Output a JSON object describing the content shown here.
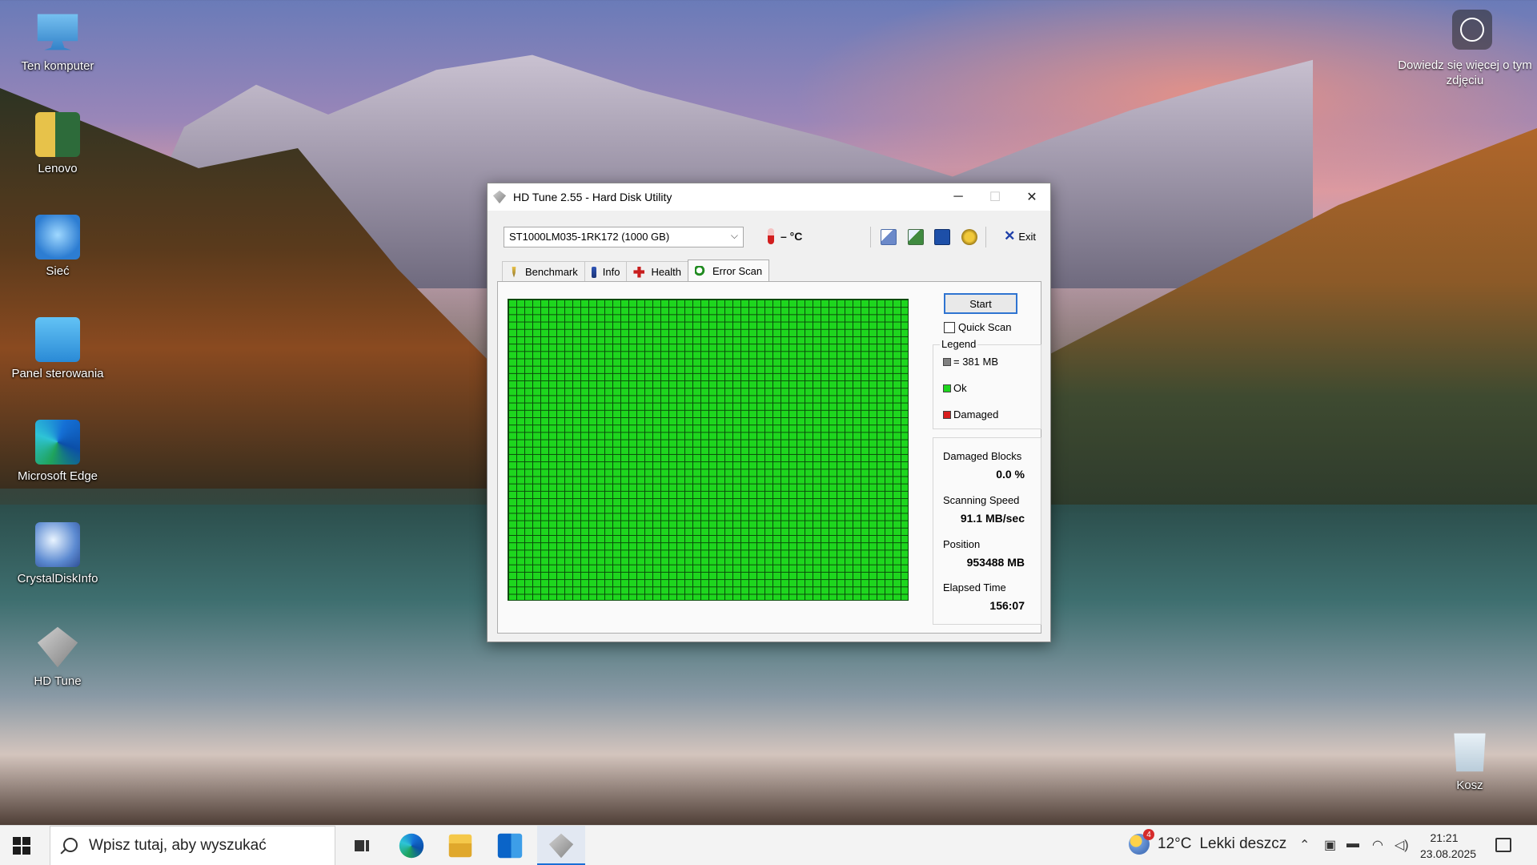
{
  "desktop": {
    "icons": [
      {
        "label": "Ten komputer",
        "icon": "computer-icon"
      },
      {
        "label": "Lenovo",
        "icon": "user-folder-icon"
      },
      {
        "label": "Sieć",
        "icon": "network-icon"
      },
      {
        "label": "Panel sterowania",
        "icon": "control-panel-icon"
      },
      {
        "label": "Microsoft Edge",
        "icon": "edge-icon"
      },
      {
        "label": "CrystalDiskInfo",
        "icon": "crystaldiskinfo-icon"
      },
      {
        "label": "HD Tune",
        "icon": "hdtune-icon"
      },
      {
        "label": "Kosz",
        "icon": "recycle-bin-icon"
      }
    ],
    "corner_text": "Dowiedz się więcej o tym zdjęciu"
  },
  "window": {
    "title": "HD Tune 2.55 - Hard Disk Utility",
    "controls": {
      "minimize": "─",
      "maximize": "☐",
      "close": "✕"
    },
    "drive": "ST1000LM035-1RK172 (1000 GB)",
    "temperature": "– °C",
    "exit_label": "Exit",
    "tabs": [
      {
        "label": "Benchmark",
        "icon": "benchmark-icon"
      },
      {
        "label": "Info",
        "icon": "info-icon"
      },
      {
        "label": "Health",
        "icon": "health-icon"
      },
      {
        "label": "Error Scan",
        "icon": "error-scan-icon"
      }
    ],
    "active_tab": "Error Scan",
    "start_label": "Start",
    "quick_scan_label": "Quick Scan",
    "quick_scan_checked": false,
    "legend": {
      "title": "Legend",
      "block_size": "= 381 MB",
      "ok": "Ok",
      "damaged": "Damaged",
      "colors": {
        "block": "#808080",
        "ok": "#1ed61e",
        "damaged": "#d81e1e"
      }
    },
    "stats": {
      "damaged_blocks_label": "Damaged Blocks",
      "damaged_blocks_value": "0.0 %",
      "scanning_speed_label": "Scanning Speed",
      "scanning_speed_value": "91.1 MB/sec",
      "position_label": "Position",
      "position_value": "953488 MB",
      "elapsed_label": "Elapsed Time",
      "elapsed_value": "156:07"
    }
  },
  "taskbar": {
    "search_placeholder": "Wpisz tutaj, aby wyszukać",
    "weather_temp": "12°C",
    "weather_desc": "Lekki deszcz",
    "weather_badge": "4",
    "time": "21:21",
    "date": "23.08.2025",
    "tray_icons": [
      "chevron-up-icon",
      "meet-icon",
      "battery-icon",
      "wifi-icon",
      "volume-icon"
    ]
  },
  "colors": {
    "scan_ok": "#1ed61e",
    "accent": "#1a6fd6"
  }
}
